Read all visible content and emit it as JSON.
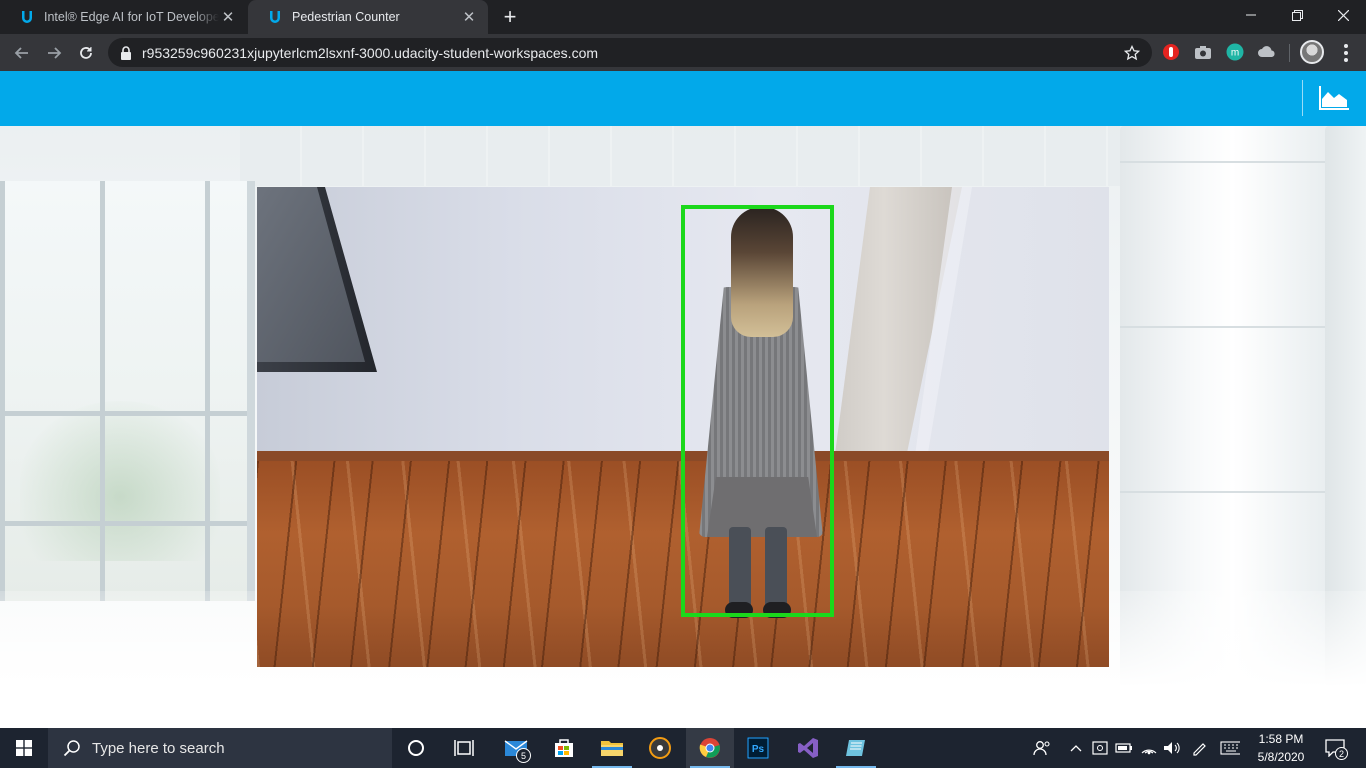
{
  "browser": {
    "tabs": [
      {
        "title": "Intel® Edge AI for IoT Developer",
        "active": false
      },
      {
        "title": "Pedestrian Counter",
        "active": true
      }
    ],
    "url": "r953259c960231xjupyterlcm2lsxnf-3000.udacity-student-workspaces.com",
    "colors": {
      "frame": "#202124",
      "toolbar": "#35363a",
      "tab_active": "#35363a"
    }
  },
  "app": {
    "header_color": "#02a9ea",
    "stats_icon": "area-chart-icon",
    "video": {
      "detection_box_color": "#1bd81b",
      "detections": 1
    }
  },
  "taskbar": {
    "search_placeholder": "Type here to search",
    "mail_badge": "5",
    "time": "1:58 PM",
    "date": "5/8/2020",
    "notifications": "2",
    "apps": [
      "task-view-icon",
      "mail-icon",
      "store-icon",
      "file-explorer-icon",
      "media-icon",
      "chrome-icon",
      "photoshop-icon",
      "visual-studio-icon",
      "notepad-icon"
    ]
  }
}
